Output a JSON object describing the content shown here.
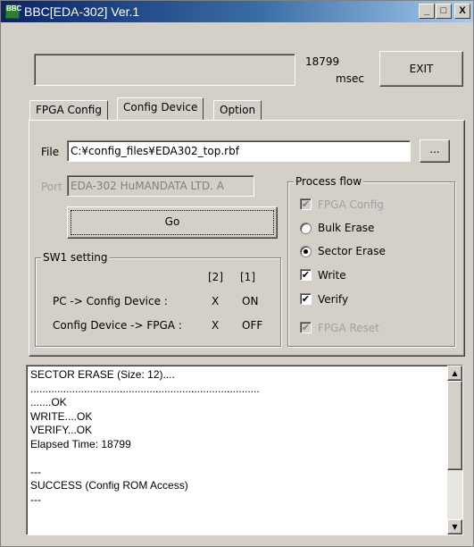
{
  "window": {
    "title": "BBC[EDA-302] Ver.1",
    "icon_text": "BBC",
    "minimize_glyph": "_",
    "maximize_glyph": "□",
    "close_glyph": "X"
  },
  "top": {
    "elapsed_value": "18799",
    "elapsed_unit": "msec",
    "exit_label": "EXIT"
  },
  "tabs": [
    {
      "label": "FPGA Config",
      "active": false
    },
    {
      "label": "Config Device",
      "active": true
    },
    {
      "label": "Option",
      "active": false
    }
  ],
  "file": {
    "label": "File",
    "value": "C:¥config_files¥EDA302_top.rbf",
    "browse_label": "..."
  },
  "port": {
    "label": "Port",
    "value": "EDA-302 HuMANDATA LTD. A"
  },
  "go_label": "Go",
  "sw1": {
    "title": "SW1 setting",
    "col_headers": [
      "[2]",
      "[1]"
    ],
    "rows": [
      {
        "label": "PC -> Config Device :",
        "c2": "X",
        "c1": "ON"
      },
      {
        "label": "Config Device -> FPGA :",
        "c2": "X",
        "c1": "OFF"
      }
    ]
  },
  "process_flow": {
    "title": "Process flow",
    "fpga_config": {
      "label": "FPGA Config",
      "checked": true,
      "enabled": false
    },
    "bulk_erase": {
      "label": "Bulk Erase",
      "selected": false
    },
    "sector_erase": {
      "label": "Sector Erase",
      "selected": true
    },
    "write": {
      "label": "Write",
      "checked": true
    },
    "verify": {
      "label": "Verify",
      "checked": true
    },
    "fpga_reset": {
      "label": "FPGA Reset",
      "checked": true,
      "enabled": false
    }
  },
  "log": {
    "text": "SECTOR ERASE (Size: 12)....\n.............................................................................\n.......OK\nWRITE....OK\nVERIFY...OK\nElapsed Time: 18799\n\n---\nSUCCESS (Config ROM Access)\n---",
    "scroll_up_glyph": "▲",
    "scroll_down_glyph": "▼"
  },
  "check_glyph": "✔"
}
